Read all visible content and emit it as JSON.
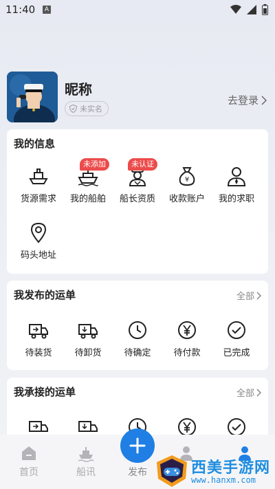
{
  "status": {
    "time": "11:40",
    "a_label": "A"
  },
  "profile": {
    "nickname": "昵称",
    "verify_badge": "未实名",
    "login_link": "去登录"
  },
  "my_info": {
    "title": "我的信息",
    "items": [
      {
        "label": "货源需求",
        "icon": "cargo-ship-icon"
      },
      {
        "label": "我的船舶",
        "icon": "ship-icon",
        "tag": "未添加"
      },
      {
        "label": "船长资质",
        "icon": "captain-icon",
        "tag": "未认证"
      },
      {
        "label": "收款账户",
        "icon": "money-bag-icon"
      },
      {
        "label": "我的求职",
        "icon": "person-tie-icon"
      },
      {
        "label": "码头地址",
        "icon": "location-pin-icon"
      }
    ]
  },
  "published": {
    "title": "我发布的运单",
    "more": "全部",
    "items": [
      {
        "label": "待装货",
        "icon": "truck-loading-icon"
      },
      {
        "label": "待卸货",
        "icon": "truck-unloading-icon"
      },
      {
        "label": "待确定",
        "icon": "clock-icon"
      },
      {
        "label": "待付款",
        "icon": "yen-circle-icon"
      },
      {
        "label": "已完成",
        "icon": "check-circle-icon"
      }
    ]
  },
  "accepted": {
    "title": "我承接的运单",
    "more": "全部"
  },
  "nav": {
    "home": "首页",
    "ship_news": "船讯",
    "publish": "发布"
  },
  "watermark": {
    "title": "西美手游网",
    "url": "www.hanxm.com"
  },
  "colors": {
    "accent": "#1f7fe4",
    "tag": "#ec4b4b"
  }
}
